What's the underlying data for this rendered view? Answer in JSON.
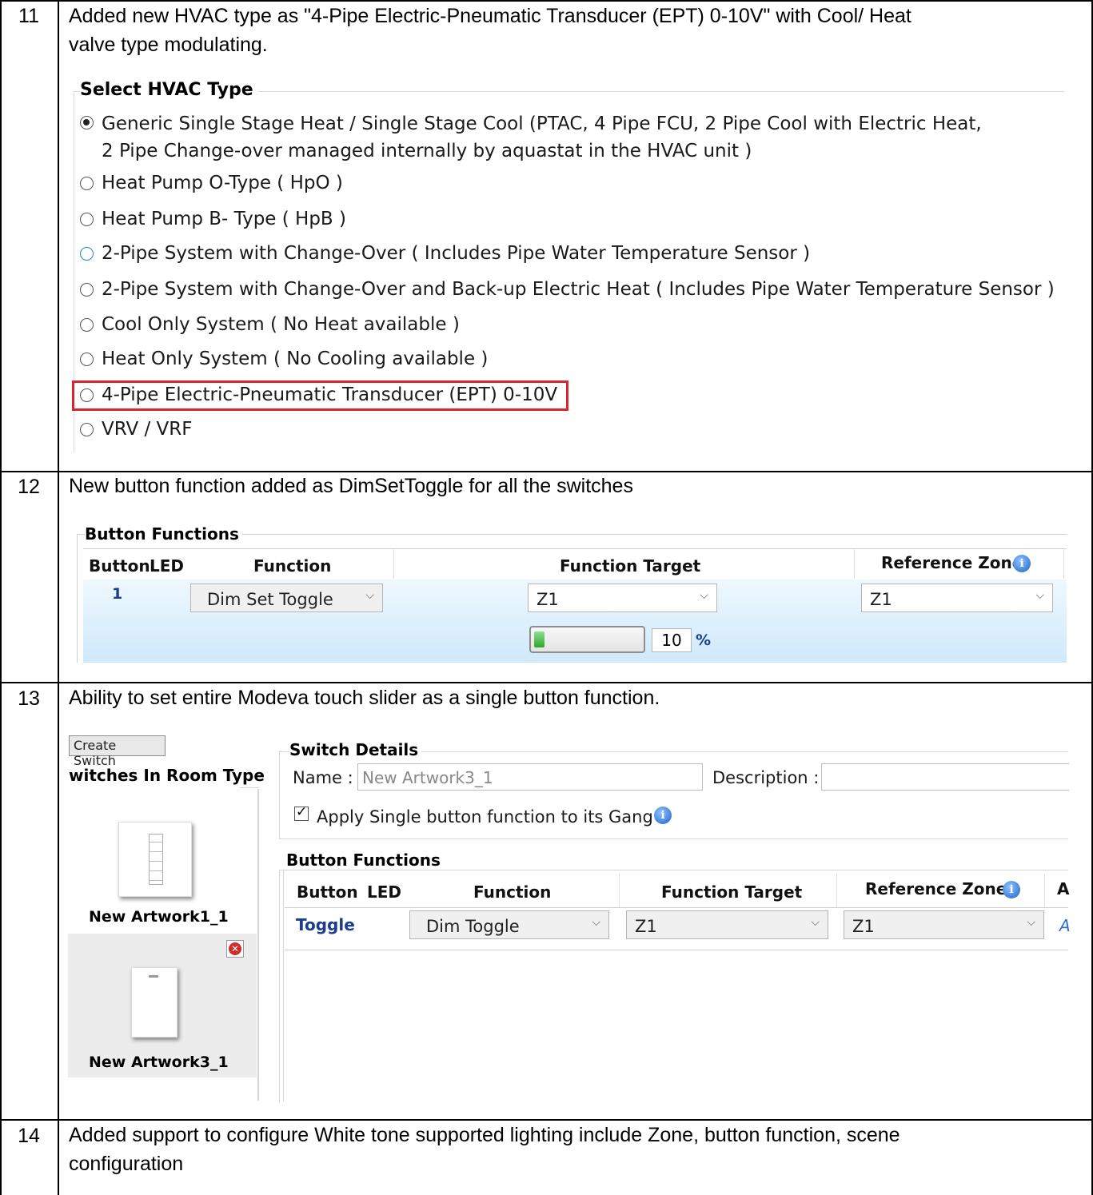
{
  "rows": [
    {
      "num": "11",
      "text_l1": "Added new HVAC type as \"4-Pipe Electric-Pneumatic Transducer (EPT) 0-10V\" with Cool/ Heat",
      "text_l2": "valve type modulating."
    },
    {
      "num": "12",
      "text_l1": "New button function added as DimSetToggle for all the switches"
    },
    {
      "num": "13",
      "text_l1": "Ability to set entire Modeva touch slider as a single button function."
    },
    {
      "num": "14",
      "text_l1": "Added support to configure White tone supported lighting include Zone, button function, scene",
      "text_l2": "configuration"
    }
  ],
  "hvac": {
    "title": "Select HVAC Type",
    "options": [
      {
        "label": "Generic Single Stage Heat / Single Stage Cool (PTAC, 4 Pipe FCU, 2 Pipe Cool with Electric Heat,",
        "label2": "2 Pipe Change-over managed internally by aquastat in the HVAC unit )",
        "selected": true
      },
      {
        "label": "Heat Pump O-Type ( HpO )",
        "selected": false
      },
      {
        "label": "Heat Pump B- Type ( HpB )",
        "selected": false
      },
      {
        "label": "2-Pipe System with Change-Over ( Includes Pipe Water Temperature Sensor )",
        "selected": false
      },
      {
        "label": "2-Pipe System with Change-Over and Back-up Electric Heat ( Includes Pipe Water Temperature Sensor )",
        "selected": false
      },
      {
        "label": "Cool Only System ( No Heat available )",
        "selected": false
      },
      {
        "label": "Heat Only System ( No Cooling available )",
        "selected": false
      },
      {
        "label": "4-Pipe Electric-Pneumatic Transducer (EPT) 0-10V",
        "selected": false,
        "highlighted": true
      },
      {
        "label": "VRV / VRF",
        "selected": false
      }
    ]
  },
  "bf12": {
    "title": "Button Functions",
    "headers": {
      "button": "Button",
      "led": "LED",
      "function": "Function",
      "target": "Function Target",
      "refzone": "Reference Zone"
    },
    "row": {
      "button": "1",
      "function": "Dim Set Toggle",
      "target": "Z1",
      "refzone": "Z1",
      "level_value": "10",
      "level_unit": "%",
      "level_fraction": 0.1
    },
    "colors": {
      "row_bg": "#cfe9fb",
      "row_bg_top": "#eef8ff"
    }
  },
  "r13": {
    "create_button": "Create Switch",
    "switches_title": "witches In Room Type",
    "switches": [
      {
        "name": "New Artwork1_1"
      },
      {
        "name": "New Artwork3_1"
      }
    ],
    "details_title": "Switch Details",
    "name_label": "Name :",
    "name_value": "New Artwork3_1",
    "desc_label": "Description :",
    "apply_label": "Apply Single button function to its Gang",
    "apply_checked": true,
    "bf_title": "Button Functions",
    "headers": {
      "button": "Button",
      "led": "LED",
      "function": "Function",
      "target": "Function Target",
      "refzone": "Reference Zone",
      "extra": "A"
    },
    "row": {
      "button": "Toggle",
      "function": "Dim Toggle",
      "target": "Z1",
      "refzone": "Z1",
      "extra": "A"
    }
  },
  "icons": {
    "info": "info-icon",
    "chevron": "chevron-down-icon",
    "close": "close-icon",
    "check": "checkmark-icon"
  }
}
